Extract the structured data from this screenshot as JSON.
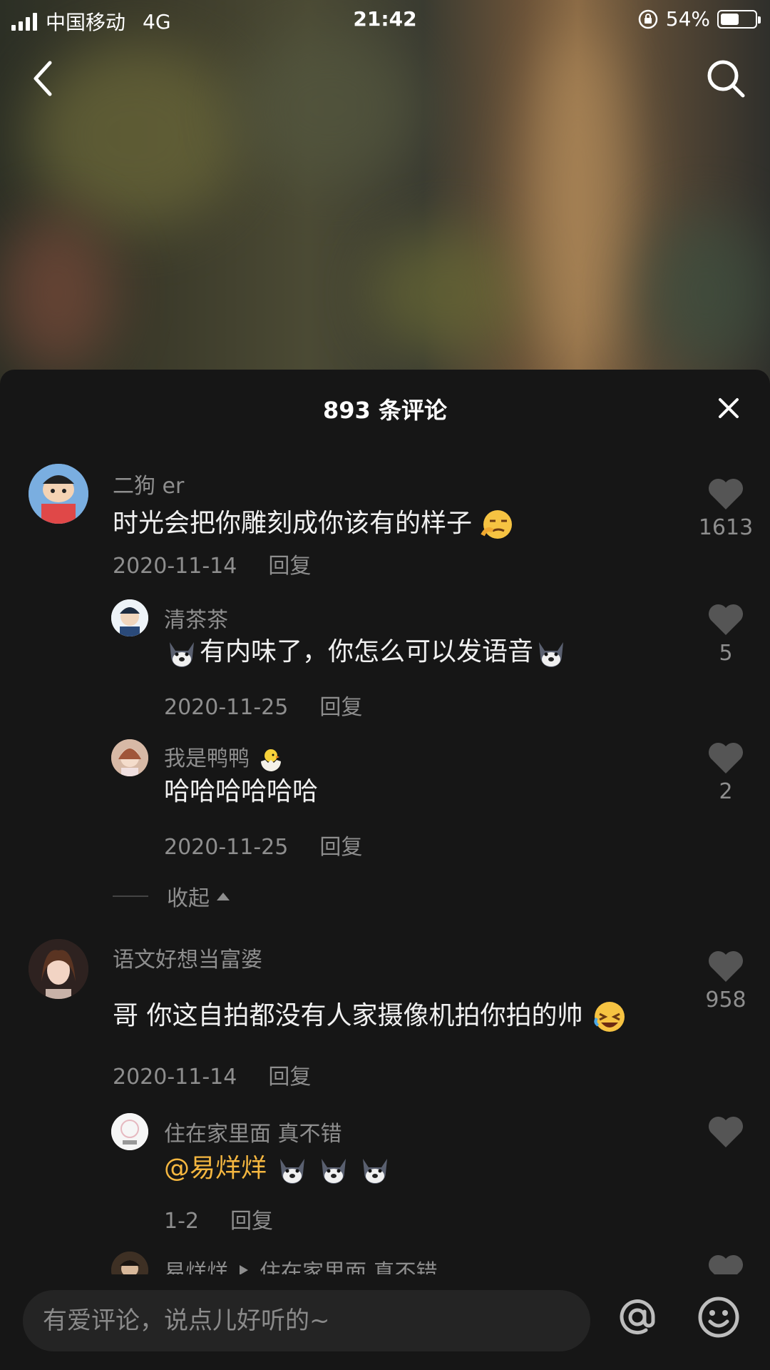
{
  "status_bar": {
    "carrier": "中国移动",
    "network": "4G",
    "time": "21:42",
    "battery": "54%",
    "battery_level": 0.54
  },
  "sheet": {
    "title": "893 条评论"
  },
  "comments": [
    {
      "author": "二狗 er",
      "text": "时光会把你雕刻成你该有的样子",
      "date": "2020-11-14",
      "reply_label": "回复",
      "likes": "1613"
    },
    {
      "author": "清茶茶",
      "text": "有内味了，你怎么可以发语音",
      "date": "2020-11-25",
      "reply_label": "回复",
      "likes": "5"
    },
    {
      "author": "我是鸭鸭",
      "text": "哈哈哈哈哈哈",
      "date": "2020-11-25",
      "reply_label": "回复",
      "likes": "2"
    },
    {
      "author": "语文好想当富婆",
      "text": "哥 你这自拍都没有人家摄像机拍你拍的帅",
      "date": "2020-11-14",
      "reply_label": "回复",
      "likes": "958"
    },
    {
      "author": "住在家里面 真不错",
      "mention": "@易烊烊",
      "date": "1-2",
      "reply_label": "回复"
    },
    {
      "author": "易烊烊",
      "reply_to": "住在家里面 真不错"
    }
  ],
  "collapse_label": "收起",
  "input": {
    "placeholder": "有爱评论，说点儿好听的~"
  },
  "icons": {
    "back": "chevron-left-icon",
    "search": "search-icon",
    "close": "close-icon",
    "like": "heart-icon",
    "mention": "at-icon",
    "emoji": "smiley-icon"
  }
}
